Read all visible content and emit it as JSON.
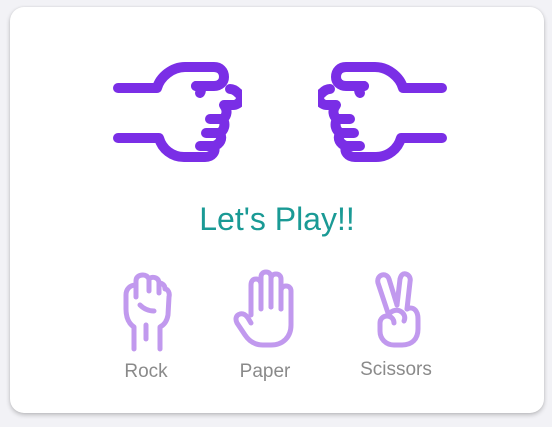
{
  "game": {
    "title": "Let's Play!!",
    "player_hand_icon": "pointing-fist-icon",
    "computer_hand_icon": "pointing-fist-icon"
  },
  "choices": [
    {
      "label": "Rock",
      "icon": "rock-hand-icon"
    },
    {
      "label": "Paper",
      "icon": "paper-hand-icon"
    },
    {
      "label": "Scissors",
      "icon": "scissors-hand-icon"
    }
  ],
  "colors": {
    "hand": "#7a2ee6",
    "choice_icon": "#c199ee",
    "title": "#1a9a95",
    "label": "#8a8a8a"
  }
}
